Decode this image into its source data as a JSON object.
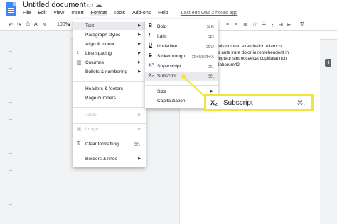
{
  "header": {
    "doc_title": "Untitled document",
    "menus": [
      "File",
      "Edit",
      "View",
      "Insert",
      "Format",
      "Tools",
      "Add-ons",
      "Help"
    ],
    "active_menu": "Format",
    "last_edit": "Last edit was 2 hours ago",
    "star_icon": "star-icon",
    "folder_icon": "folder-icon",
    "cloud_icon": "cloud-icon"
  },
  "toolbar": {
    "zoom": "100%",
    "ruler_numbers": [
      "5",
      "6",
      "7"
    ]
  },
  "document": {
    "lines": [
      "a, quis nostrud exercitation ullamco",
      "Duis aute irure dolor in reprehenderit in",
      "Excepteur sint occaecat cupidatat non",
      "est laborum42."
    ]
  },
  "format_menu": {
    "items": [
      {
        "label": "Text",
        "icon": "",
        "arrow": "▶"
      },
      {
        "label": "Paragraph styles",
        "icon": "",
        "arrow": "▶"
      },
      {
        "label": "Align & indent",
        "icon": "",
        "arrow": "▶"
      },
      {
        "label": "Line spacing",
        "icon": "line-spacing-icon",
        "arrow": "▶"
      },
      {
        "label": "Columns",
        "icon": "columns-icon",
        "arrow": "▶"
      },
      {
        "label": "Bullets & numbering",
        "icon": "",
        "arrow": "▶"
      },
      {
        "label": "Headers & footers",
        "icon": "",
        "arrow": ""
      },
      {
        "label": "Page numbers",
        "icon": "",
        "arrow": ""
      },
      {
        "label": "Table",
        "icon": "",
        "arrow": "▶"
      },
      {
        "label": "Image",
        "icon": "image-icon",
        "arrow": "▶"
      },
      {
        "label": "Clear formatting",
        "icon": "clear-formatting-icon",
        "shortcut": "⌘\\"
      },
      {
        "label": "Borders & lines",
        "icon": "",
        "arrow": "▶"
      }
    ]
  },
  "text_submenu": {
    "items": [
      {
        "label": "Bold",
        "glyph": "B",
        "shortcut": "⌘B"
      },
      {
        "label": "Italic",
        "glyph": "I",
        "shortcut": "⌘I"
      },
      {
        "label": "Underline",
        "glyph": "U",
        "shortcut": "⌘U"
      },
      {
        "label": "Strikethrough",
        "glyph": "S",
        "shortcut": "⌘+Shift+X"
      },
      {
        "label": "Superscript",
        "glyph": "X²",
        "shortcut": "⌘."
      },
      {
        "label": "Subscript",
        "glyph": "X₂",
        "shortcut": "⌘,"
      },
      {
        "label": "Size",
        "arrow": "▶"
      },
      {
        "label": "Capitalization",
        "arrow": "▶"
      }
    ]
  },
  "callout": {
    "glyph": "X₂",
    "label": "Subscript",
    "shortcut": "⌘,",
    "color": "#f2e53a"
  }
}
